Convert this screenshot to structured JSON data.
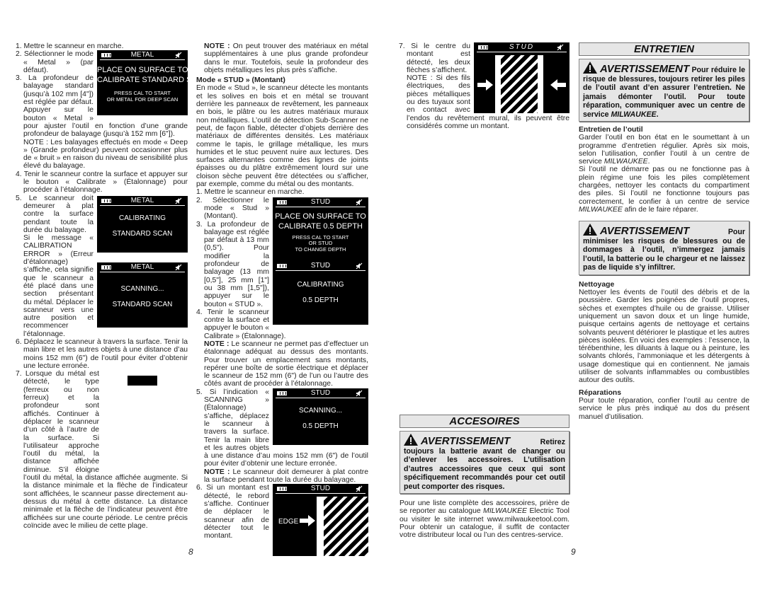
{
  "left_page": {
    "page_number": "8",
    "col1": {
      "li1": "1. Mettre le scanneur en marche.",
      "li2": "2. Sélectionner le mode « Metal » (par défaut).",
      "li3": "3. La profondeur de balayage standard (jusqu’à 102 mm [4\"]) est réglée par défaut. Appuyer sur le bouton « Metal » pour ajuster l’outil en fonction d’une grande profondeur de balayage (jusqu’à 152 mm [6\"]).",
      "note": "NOTE : Les balayages effectués en mode « Deep » (Grande profondeur) peuvent occasionner plus de « bruit » en raison du niveau de sensibilité plus élevé du balayage.",
      "li4": "4. Tenir le scanneur contre la surface et appuyer sur le bouton « Calibrate » (Étalonnage) pour procéder à l’étalonnage.",
      "li5": "5. Le scanneur doit demeurer à plat contre la surface pendant toute la durée du balayage.",
      "li5b": "Si le message « CALIBRATION ERROR » (Erreur d’étalonnage) s’affiche, cela signifie que le scanneur a été placé dans une section présentant du métal. Déplacer le scanneur vers une autre position et recommencer l’étalonnage.",
      "li6": "6. Déplacez le scanneur à travers la surface. Tenir la main libre et les autres objets à une distance d’au moins 152 mm (6\") de l’outil pour éviter d’obtenir une lecture erronée.",
      "li7": "7. Lorsque du métal est détecté, le type (ferreux ou non ferreux) et la profondeur sont affichés. Continuer à déplacer le scanneur d’un côté à l’autre de la surface. Si l’utilisateur approche l’outil du métal, la distance affichée diminue. S’il éloigne l’outil du métal, la distance affichée augmente. Si la distance minimale et la flèche de l’indicateur sont affichées, le scanneur passe directement au-dessus du métal à cette distance. La distance minimale et la flèche de l’indicateur peuvent être affichées sur une courte période. Le centre précis coïncide avec le milieu de cette plage.",
      "screen1": {
        "title": "METAL",
        "line1": "PLACE ON SURFACE TO",
        "line2": "CALIBRATE STANDARD SCAN",
        "small1": "PRESS  CAL  TO START",
        "small2": "OR  METAL  FOR DEEP SCAN"
      },
      "screen2": {
        "title": "METAL",
        "line1": "CALIBRATING",
        "line2": "STANDARD SCAN"
      },
      "screen3": {
        "title": "METAL",
        "line1": "SCANNING...",
        "line2": "STANDARD SCAN"
      }
    },
    "col2": {
      "note1_label": "NOTE :",
      "note1": " On peut trouver des matériaux en métal supplémentaires à une plus grande profondeur dans le mur. Toutefois, seule la profondeur des objets métalliques les plus près s’affiche.",
      "heading": "Mode « STUD » (Montant)",
      "intro": "En mode « Stud », le scanneur détecte les montants et les solives en bois et en métal se trouvant derrière les panneaux de revêtement, les panneaux en bois, le plâtre ou les autres matériaux muraux non métalliques. L’outil de détection Sub-Scanner ne peut, de façon fiable, détecter d’objets derrière des matériaux de différentes densités. Les matériaux comme le tapis, le grillage métallique, les murs humides et le stuc peuvent nuire aux lectures. Des surfaces alternantes comme des lignes de joints épaisses ou du plâtre extrêmement lourd sur une cloison sèche peuvent être détectées ou s’afficher, par exemple, comme du métal ou des montants.",
      "li1": "1. Mettre le scanneur en marche.",
      "li2": "2. Sélectionner le mode « Stud » (Montant).",
      "li3": "3. La profondeur de balayage est réglée par défaut à 13 mm (0,5\"). Pour modifier la profondeur de balayage (13 mm [0,5\"], 25 mm [1\"] ou 38 mm [1,5\"]), appuyer sur le bouton « STUD ».",
      "li4": "4. Tenir le scanneur contre la surface et appuyer le bouton « Calibrate » (Étalonnage).",
      "note2_label": "NOTE :",
      "note2": " Le scanneur ne permet pas d’effectuer un étalonnage adéquat au dessus des montants. Pour trouver un emplacement sans montants, repérer une boîte de sortie électrique et déplacer le scanneur de 152 mm (6\") de l’un ou l’autre des côtés avant de procéder à l’étalonnage.",
      "li5": "5. Si l’indication « SCANNING » (Étalonnage) s’affiche, déplacez le scanneur à travers la surface. Tenir la main libre et les autres objets à une distance d’au moins 152 mm (6\") de l’outil pour éviter d’obtenir une lecture erronée.",
      "note3_label": "NOTE :",
      "note3": " Le scanneur doit demeurer à plat contre la surface pendant toute la durée du balayage.",
      "li6": "6. Si un montant est détecté, le rebord s’affiche. Continuer de déplacer le scanneur afin de détecter tout le montant.",
      "screen1": {
        "title": "STUD",
        "line1": "PLACE ON SURFACE TO",
        "line2": "CALIBRATE 0.5  DEPTH",
        "small1": "PRESS  CAL  TO START",
        "small2": "OR  STUD",
        "small3": "TO CHANGE DEPTH"
      },
      "screen2": {
        "title": "STUD",
        "line1": "CALIBRATING",
        "line2": "0.5  DEPTH"
      },
      "screen3": {
        "title": "STUD",
        "line1": "SCANNING...",
        "line2": "0.5  DEPTH"
      },
      "screen4": {
        "title": "STUD",
        "edge": "EDGE"
      }
    }
  },
  "right_page": {
    "page_number": "9",
    "col3": {
      "li7": "7. Si le centre du montant est détecté, les deux flèches s’affichent.",
      "note": "NOTE : Si des fils électriques, des pièces métalliques ou des tuyaux sont en contact avec l’endos du revêtement mural, ils peuvent être considérés comme un montant.",
      "screen": {
        "title": "STUD"
      },
      "accessories": {
        "title": "ACCESOIRES",
        "warning_word": "AVERTISSEMENT",
        "warning_text": " Retirez toujours la batterie avant de changer ou d’enlever les accessoires. L’utilisation d’autres accessoires que ceux qui sont spécifiquement recommandés pour cet outil peut comporter des risques.",
        "p_a": "Pour une liste complète des accessoires, prière de se reporter au catalogue ",
        "brand": "MILWAUKEE",
        "p_b": " Electric Tool ou visiter le site internet www.milwaukeetool.com. Pour obtenir un catalogue, il suffit de contacter votre distributeur local ou l’un des centres-service."
      }
    },
    "col4": {
      "title": "ENTRETIEN",
      "warn1_word": "AVERTISSEMENT",
      "warn1_text": " Pour réduire le risque de blessures, toujours retirer les piles de l’outil avant d’en assurer l’entretien. Ne jamais démonter l’outil. Pour toute réparation, communiquer avec un centre de service ",
      "brand": "MILWAUKEE",
      "warn1_end": ".",
      "h_entretien": "Entretien de l’outil",
      "p1a": "Garder l’outil en bon état en le soumettant à un programme d’entretien régulier. Après six mois, selon l’utilisation, confier l’outil à un centre de service ",
      "p1b": ".",
      "p2a": "Si l’outil ne démarre pas ou ne fonctionne pas à plein régime une fois les piles complètement chargées, nettoyer les contacts du compartiment des piles. Si l’outil ne fonctionne toujours pas correctement, le confier à un centre de service ",
      "p2b": " afin de le faire réparer.",
      "warn2_word": "AVERTISSEMENT",
      "warn2_text": " Pour minimiser les risques de blessures ou de dommages à l’outil, n’immergez jamais l’outil, la batterie ou le chargeur et ne laissez pas de liquide s’y infiltrer.",
      "h_nettoyage": "Nettoyage",
      "p_nettoyage": "Nettoyer les évents de l’outil des débris et de la poussière. Garder les poignées de l’outil propres, sèches et exemptes d’huile ou de graisse. Utiliser uniquement un savon doux et un linge humide, puisque certains agents de nettoyage et certains solvants peuvent détériorer le plastique et les autres pièces isolées. En voici des exemples : l’essence, la térébenthine, les diluants à laque ou à peinture, les solvants chlorés, l’ammoniaque et les détergents à usage domestique qui en contiennent. Ne jamais utiliser de solvants inflammables ou combustibles autour des outils.",
      "h_reparations": "Réparations",
      "p_reparations": "Pour toute réparation, confier l’outil au centre de service le plus près indiqué au dos du présent manuel d’utilisation."
    }
  }
}
